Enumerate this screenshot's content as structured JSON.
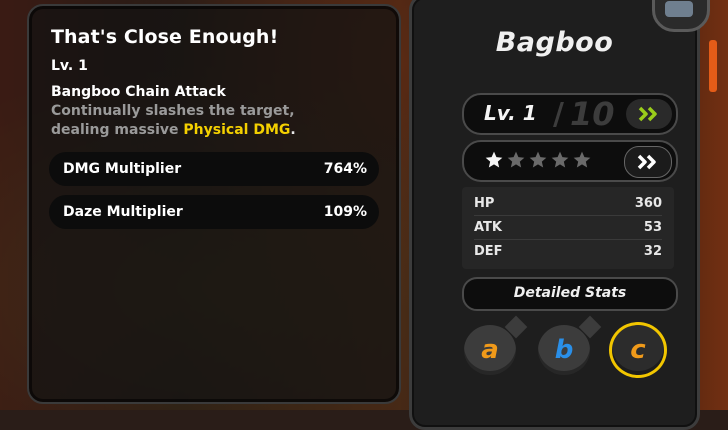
{
  "skill_panel": {
    "title": "That's Close Enough!",
    "level": "Lv. 1",
    "attack_name": "Bangboo Chain Attack",
    "description_line1": "Continually slashes the target,",
    "description_prefix": "dealing massive ",
    "description_highlight": "Physical DMG",
    "description_suffix": ".",
    "stats": [
      {
        "label": "DMG Multiplier",
        "value": "764%"
      },
      {
        "label": "Daze Multiplier",
        "value": "109%"
      }
    ]
  },
  "agent_panel": {
    "name": "Bagboo",
    "level_label": "Lv. 1",
    "level_separator": "/",
    "level_max": "10",
    "stars_filled": 1,
    "stars_total": 5,
    "stats": [
      {
        "key": "HP",
        "value": "360"
      },
      {
        "key": "ATK",
        "value": "53"
      },
      {
        "key": "DEF",
        "value": "32"
      }
    ],
    "detailed_stats_label": "Detailed Stats",
    "skill_slots": [
      {
        "letter": "a",
        "color": "#f09a1a",
        "selected": false
      },
      {
        "letter": "b",
        "color": "#2a8fe8",
        "selected": false
      },
      {
        "letter": "c",
        "color": "#f09a1a",
        "selected": true
      }
    ]
  },
  "colors": {
    "highlight": "#f4d000",
    "selected_ring": "#f2c600",
    "level_up_chevron": "#9acd1a"
  }
}
